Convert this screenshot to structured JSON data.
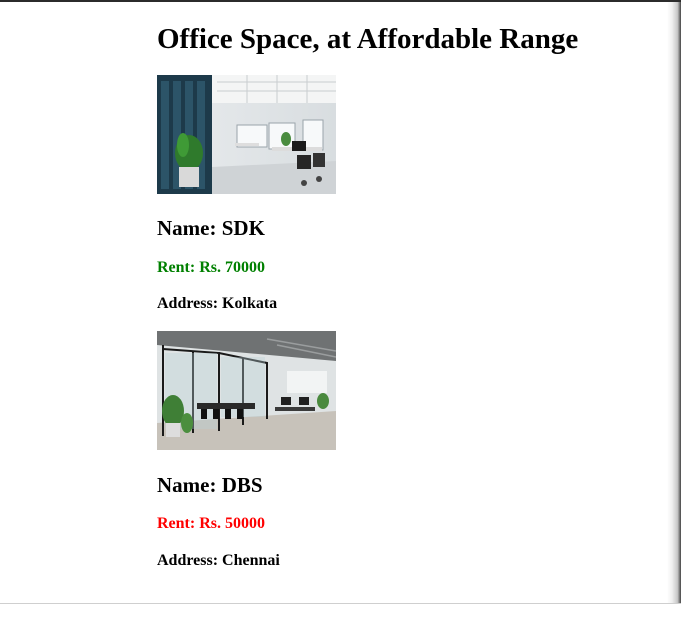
{
  "page": {
    "title": "Office Space, at Affordable Range"
  },
  "offices": [
    {
      "image_icon": "office-interior-photo",
      "name": "Name: SDK",
      "rent": "Rent: Rs. 70000",
      "rent_color": "#008000",
      "address": "Address: Kolkata"
    },
    {
      "image_icon": "glass-meeting-room-photo",
      "name": "Name: DBS",
      "rent": "Rent: Rs. 50000",
      "rent_color": "#ff0000",
      "address": "Address: Chennai"
    }
  ]
}
